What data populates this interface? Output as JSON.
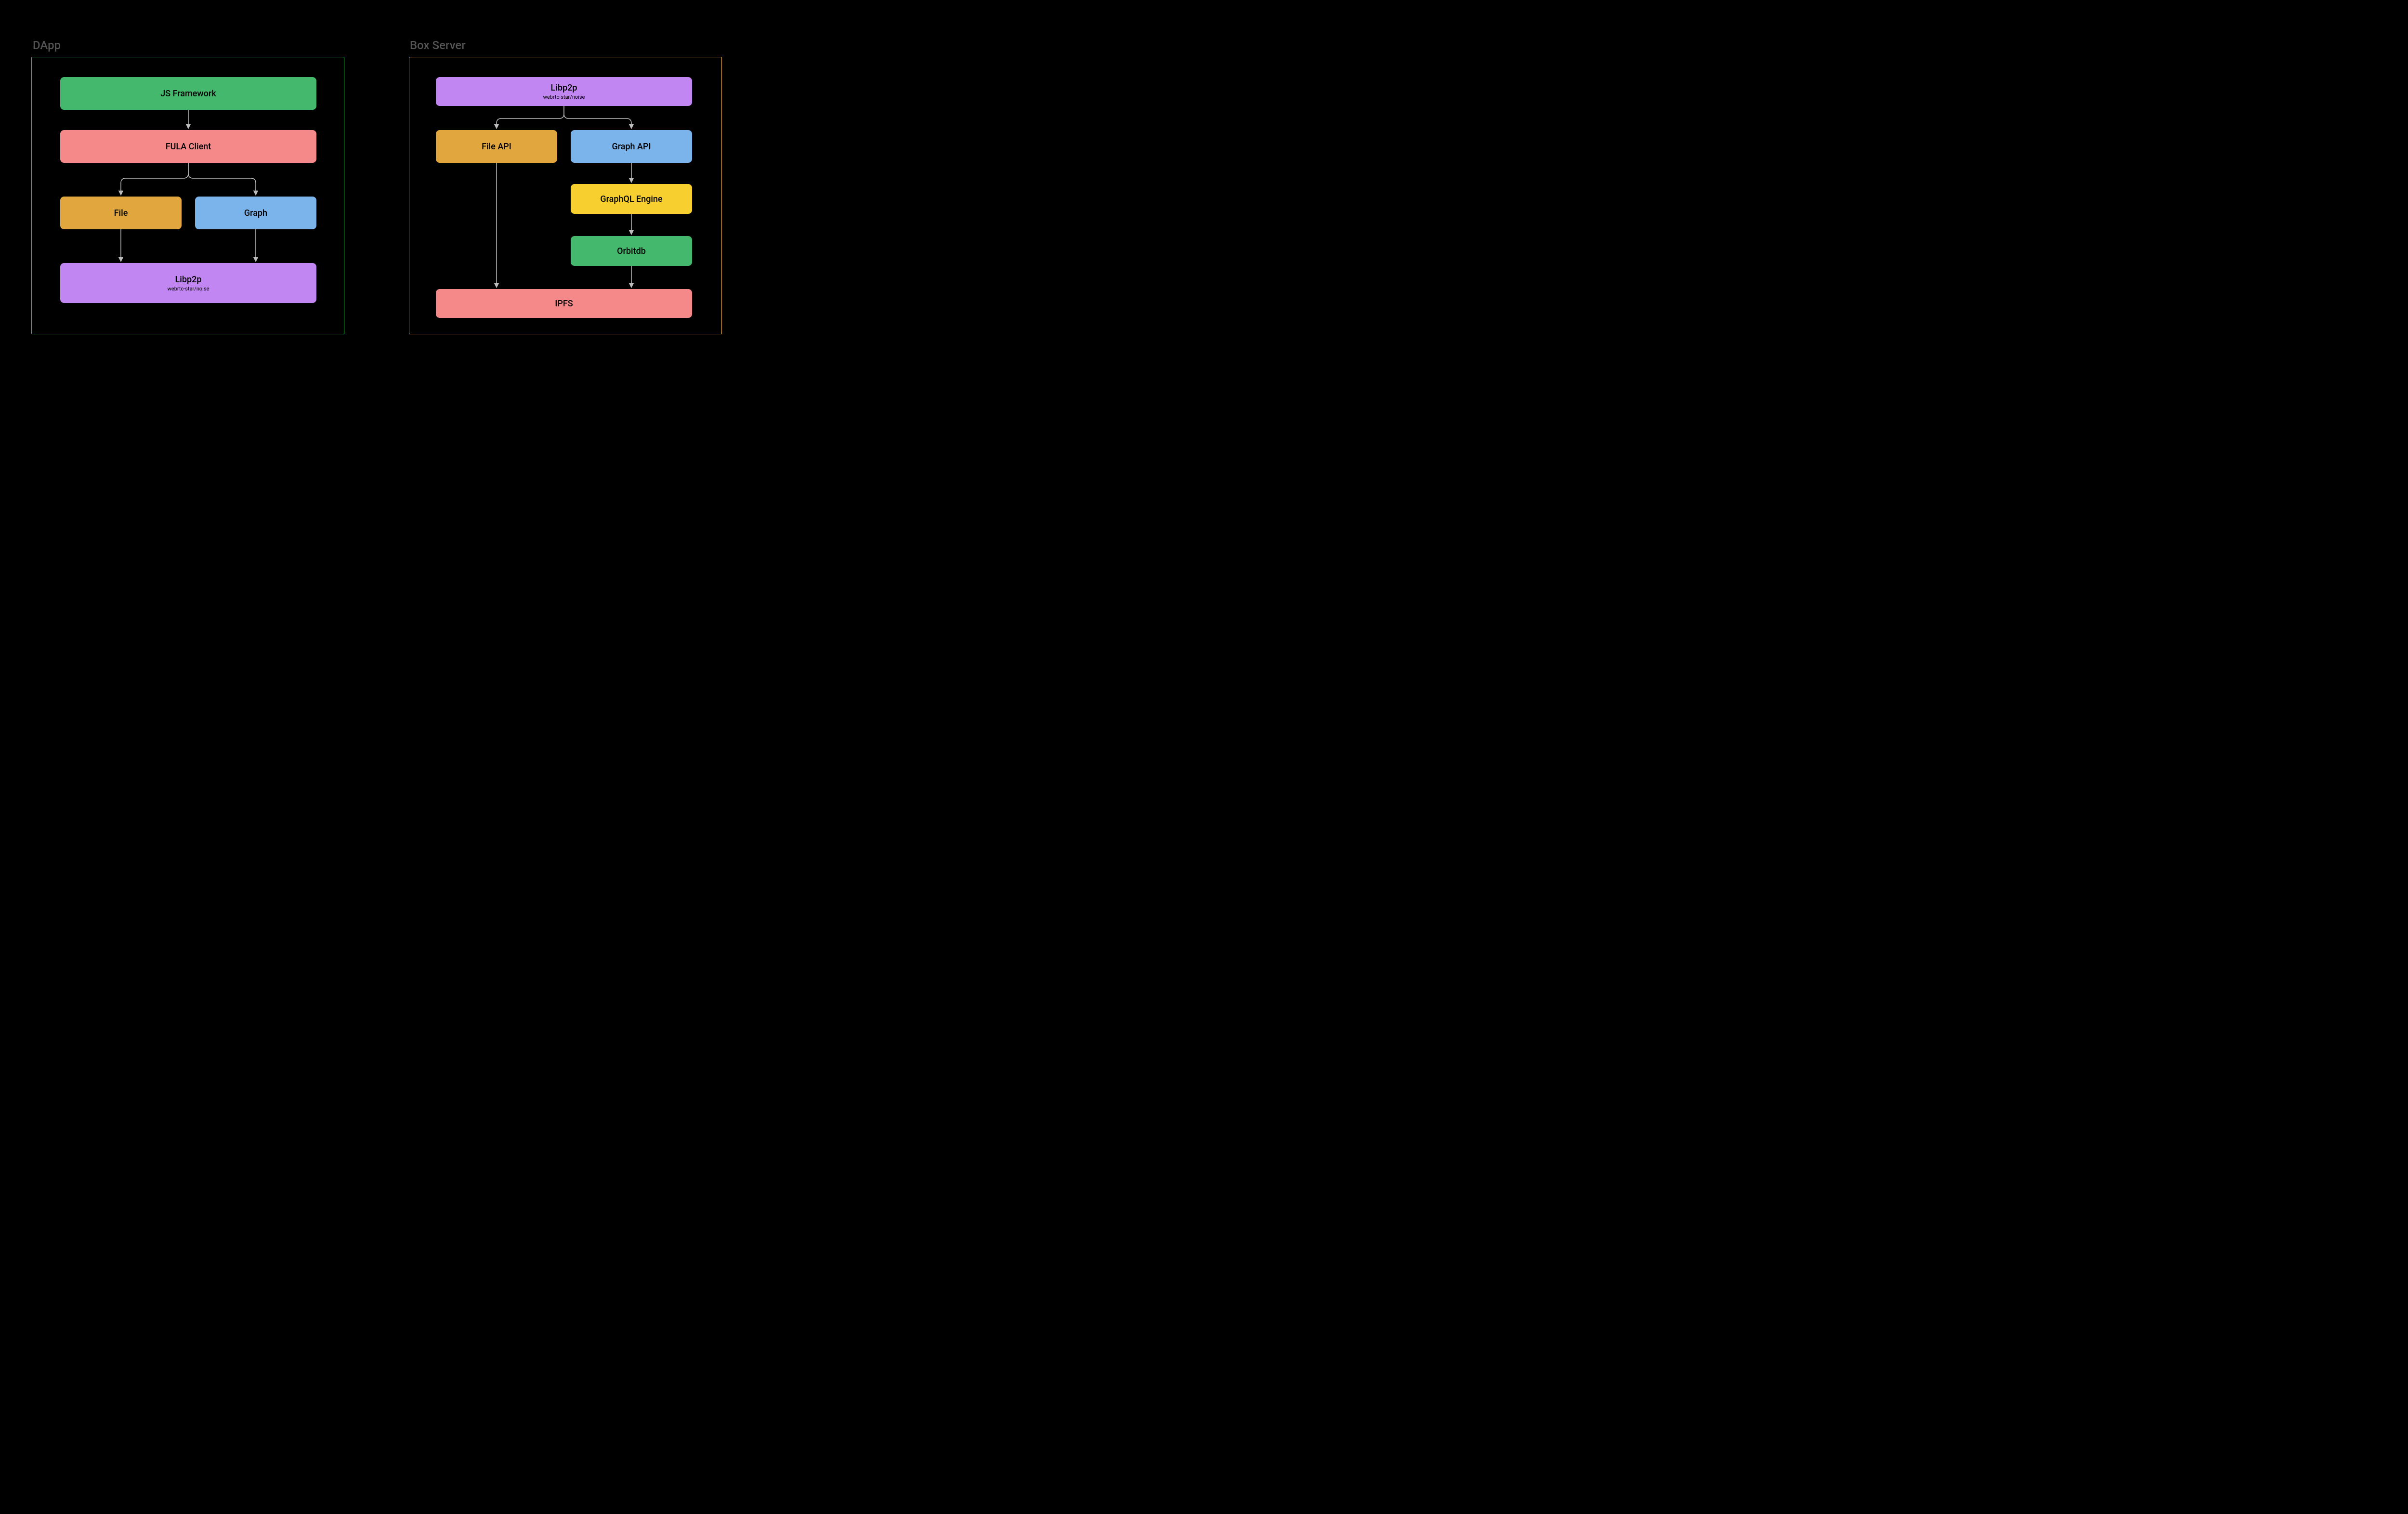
{
  "dapp": {
    "title": "DApp",
    "js_framework": "JS Framework",
    "fula_client": "FULA Client",
    "file": "File",
    "graph": "Graph",
    "libp2p": {
      "title": "Libp2p",
      "sub": "webrtc-star/noise"
    }
  },
  "box": {
    "title": "Box Server",
    "libp2p": {
      "title": "Libp2p",
      "sub": "webrtc-star/noise"
    },
    "file_api": "File API",
    "graph_api": "Graph API",
    "graphql_engine": "GraphQL Engine",
    "orbitdb": "Orbitdb",
    "ipfs": "IPFS"
  },
  "colors": {
    "green": "#44B86C",
    "pink": "#F58989",
    "orange": "#E1A63E",
    "blue": "#7BB3EB",
    "yellow": "#F7CF2F",
    "purple": "#C186F1",
    "frame_green": "#2DBD53",
    "frame_orange": "#E7A13C",
    "arrow": "#BABBBC"
  }
}
